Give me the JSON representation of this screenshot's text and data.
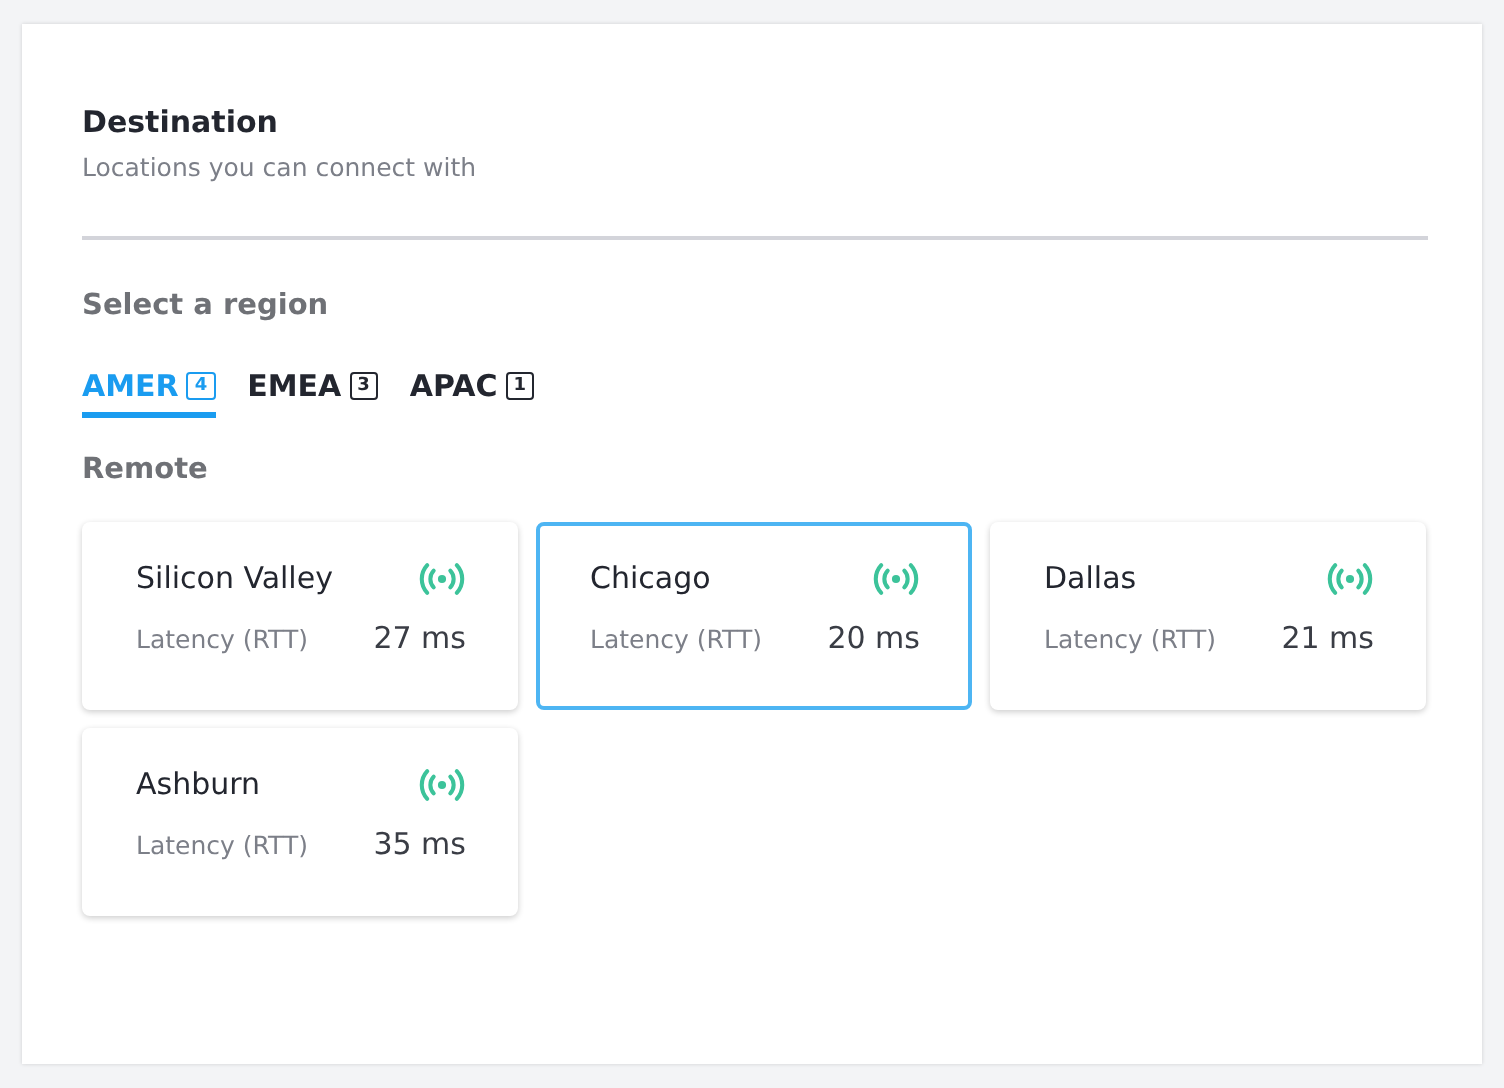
{
  "header": {
    "title": "Destination",
    "subtitle": "Locations you can connect with"
  },
  "region_label": "Select a region",
  "tabs": [
    {
      "label": "AMER",
      "count": "4",
      "selected": true
    },
    {
      "label": "EMEA",
      "count": "3",
      "selected": false
    },
    {
      "label": "APAC",
      "count": "1",
      "selected": false
    }
  ],
  "section_label": "Remote",
  "locations": [
    {
      "name": "Silicon Valley",
      "latency_label": "Latency (RTT)",
      "latency": "27 ms",
      "selected": false
    },
    {
      "name": "Chicago",
      "latency_label": "Latency (RTT)",
      "latency": "20 ms",
      "selected": true
    },
    {
      "name": "Dallas",
      "latency_label": "Latency (RTT)",
      "latency": "21 ms",
      "selected": false
    },
    {
      "name": "Ashburn",
      "latency_label": "Latency (RTT)",
      "latency": "35 ms",
      "selected": false
    }
  ]
}
